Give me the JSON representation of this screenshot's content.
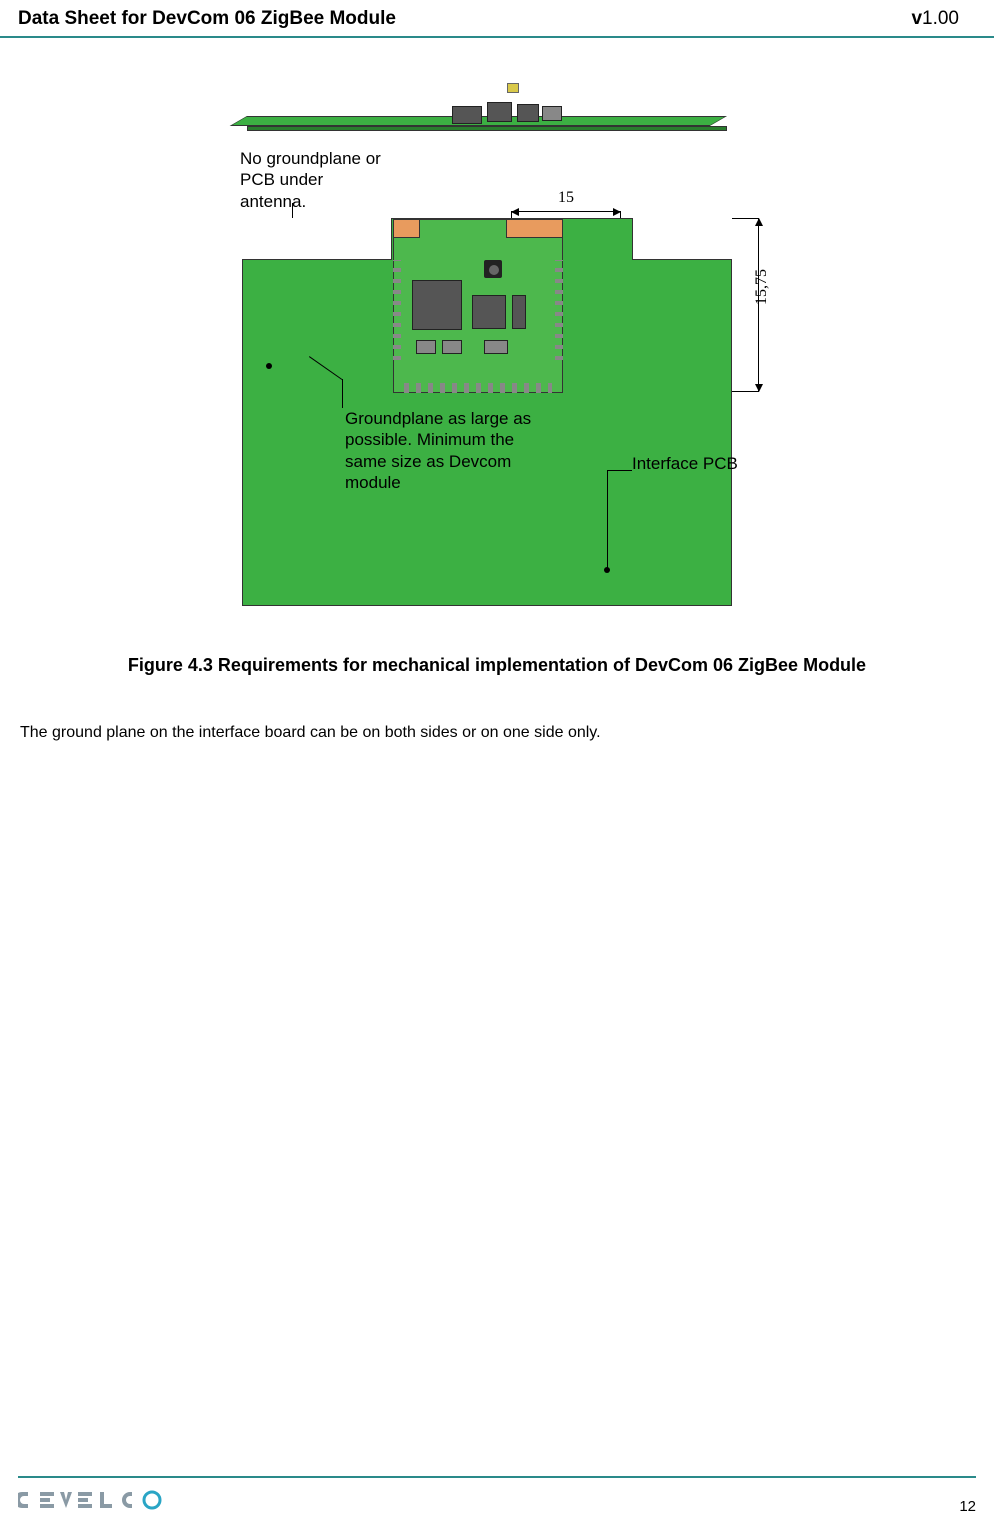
{
  "header": {
    "title": "Data Sheet for DevCom 06 ZigBee Module",
    "version_prefix": "v",
    "version_number": "1.00"
  },
  "figure": {
    "annotation_no_ground": "No groundplane or PCB under antenna.",
    "annotation_groundplane": "Groundplane as large as possible. Minimum the same size as Devcom module",
    "annotation_interface": "Interface PCB",
    "dim_width": "15",
    "dim_height": "15,75",
    "caption": "Figure 4.3 Requirements for mechanical implementation of DevCom 06 ZigBee Module"
  },
  "body": {
    "text": "The ground plane on the interface board can be on both sides or on one side only."
  },
  "footer": {
    "logo_text": "D E V E L C",
    "page_number": "12"
  }
}
